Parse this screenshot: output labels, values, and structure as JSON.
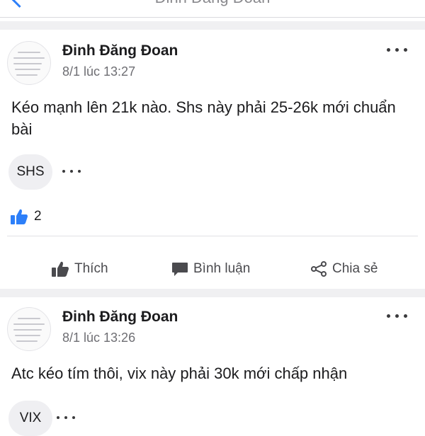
{
  "header": {
    "title": "Đinh Đăng Đoan"
  },
  "posts": [
    {
      "author": "Đinh Đăng Đoan",
      "time": "8/1 lúc 13:27",
      "text": "Kéo mạnh lên 21k nào. Shs này phải 25-26k mới chuẩn bài",
      "tag": "SHS",
      "likes": "2"
    },
    {
      "author": "Đinh Đăng Đoan",
      "time": "8/1 lúc 13:26",
      "text": "Atc kéo tím thôi, vix này phải 30k mới chấp nhận",
      "tag": "VIX"
    }
  ],
  "actions": {
    "like": "Thích",
    "comment": "Bình luận",
    "share": "Chia sẻ"
  },
  "colors": {
    "accent": "#2d7ff9",
    "separator": "#f0f0f2"
  }
}
